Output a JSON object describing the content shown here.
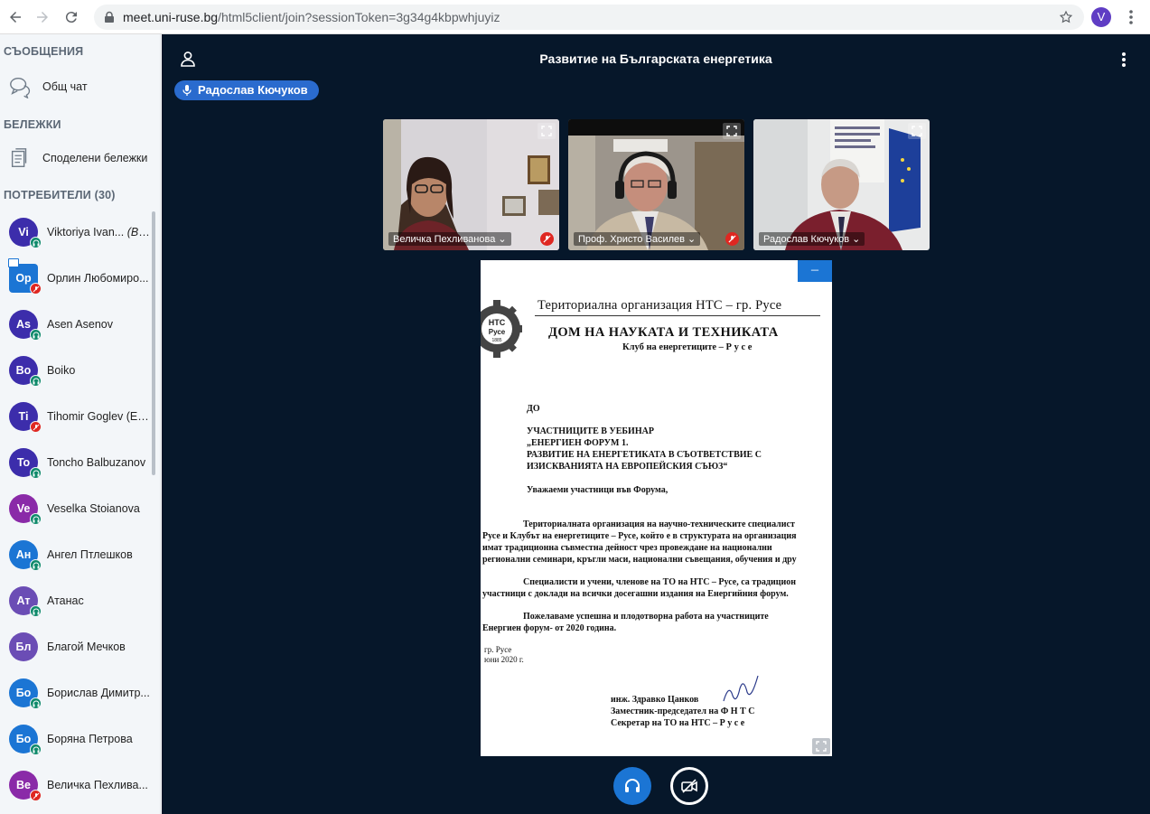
{
  "browser": {
    "url_host": "meet.uni-ruse.bg",
    "url_path": "/html5client/join?sessionToken=3g34g4kbpwhjuyiz",
    "profile_initial": "V"
  },
  "sidebar": {
    "messages_title": "СЪОБЩЕНИЯ",
    "public_chat": "Общ чат",
    "notes_title": "БЕЛЕЖКИ",
    "shared_notes": "Споделени бележки",
    "users_title": "ПОТРЕБИТЕЛИ (30)",
    "users": [
      {
        "initials": "Vi",
        "name": "Viktoriya Ivan...",
        "you": "(Вие)",
        "color": "#3c2dab",
        "status": "listen"
      },
      {
        "initials": "Op",
        "name": "Орлин Любомиро...",
        "you": "",
        "color": "#1b75d4",
        "status": "muted",
        "presenter": true
      },
      {
        "initials": "As",
        "name": "Asen Asenov",
        "you": "",
        "color": "#3c2dab",
        "status": "listen"
      },
      {
        "initials": "Bo",
        "name": "Boiko",
        "you": "",
        "color": "#3c2dab",
        "status": "listen"
      },
      {
        "initials": "Ti",
        "name": "Tihomir Goglev (ESO)",
        "you": "",
        "color": "#3c2dab",
        "status": "muted"
      },
      {
        "initials": "To",
        "name": "Toncho Balbuzanov",
        "you": "",
        "color": "#3c2dab",
        "status": "listen"
      },
      {
        "initials": "Ve",
        "name": "Veselka Stoianova",
        "you": "",
        "color": "#8a2aa8",
        "status": "listen"
      },
      {
        "initials": "Ан",
        "name": "Ангел Птлешков",
        "you": "",
        "color": "#1b75d4",
        "status": "listen"
      },
      {
        "initials": "Ат",
        "name": "Атанас",
        "you": "",
        "color": "#6b4db5",
        "status": "listen"
      },
      {
        "initials": "Бл",
        "name": "Благой Мечков",
        "you": "",
        "color": "#6b4db5",
        "status": "none"
      },
      {
        "initials": "Бо",
        "name": "Борислав Димитр...",
        "you": "",
        "color": "#1b75d4",
        "status": "listen"
      },
      {
        "initials": "Бо",
        "name": "Боряна Петрова",
        "you": "",
        "color": "#1b75d4",
        "status": "listen"
      },
      {
        "initials": "Ве",
        "name": "Величка Пехлива...",
        "you": "",
        "color": "#8a2aa8",
        "status": "muted"
      }
    ]
  },
  "meeting": {
    "title": "Развитие на Българската енергетика",
    "talking": "Радослав Кючуков"
  },
  "videos": [
    {
      "name": "Величка Пехливанова",
      "muted": true
    },
    {
      "name": "Проф. Христо Василев",
      "muted": true
    },
    {
      "name": "Радослав Кючуков",
      "muted": false
    }
  ],
  "document": {
    "minimize_label": "–",
    "logo_text": "НТС Русе 1885",
    "org_line": "Териториална организация  НТС – гр. Русе",
    "house": "ДОМ  НА  НАУКАТА И ТЕХНИКАТА",
    "club": "Клуб на енергетиците – Р у с е",
    "to": "ДО",
    "addr1": "УЧАСТНИЦИТЕ В УЕБИНАР",
    "addr2": "„ЕНЕРГИЕН ФОРУМ 1.",
    "addr3": "РАЗВИТИЕ НА ЕНЕРГЕТИКАТА В  СЪОТВЕТСТВИЕ С",
    "addr4": "ИЗИСКВАНИЯТА НА ЕВРОПЕЙСКИЯ СЪЮЗ“",
    "greeting": "Уважаеми участници във Форума,",
    "p1a": "Териториалната организация на научно-техническите специалист",
    "p1b": "Русе и Клубът на енергетиците – Русе, който е в структурата на организация",
    "p1c": "имат традиционна съвместна дейност чрез провеждане на национални",
    "p1d": "регионални семинари, кръгли маси, национални съвещания, обучения и дру",
    "p2a": "Специалисти и учени, членове на  ТО на НТС – Русе, са традицион",
    "p2b": "участници с доклади на всички досегашни издания на Енергийния форум.",
    "p3a": "Пожелаваме успешна и плодотворна работа на участниците",
    "p3b": "Енергиен форум- от 2020 година.",
    "place": "гр. Русе",
    "date": "юни 2020  г.",
    "sign1": "инж. Здравко Цанков",
    "sign2": "Заместник-председател на Ф Н Т С",
    "sign3": "Секретар на ТО на НТС – Р у с е"
  }
}
